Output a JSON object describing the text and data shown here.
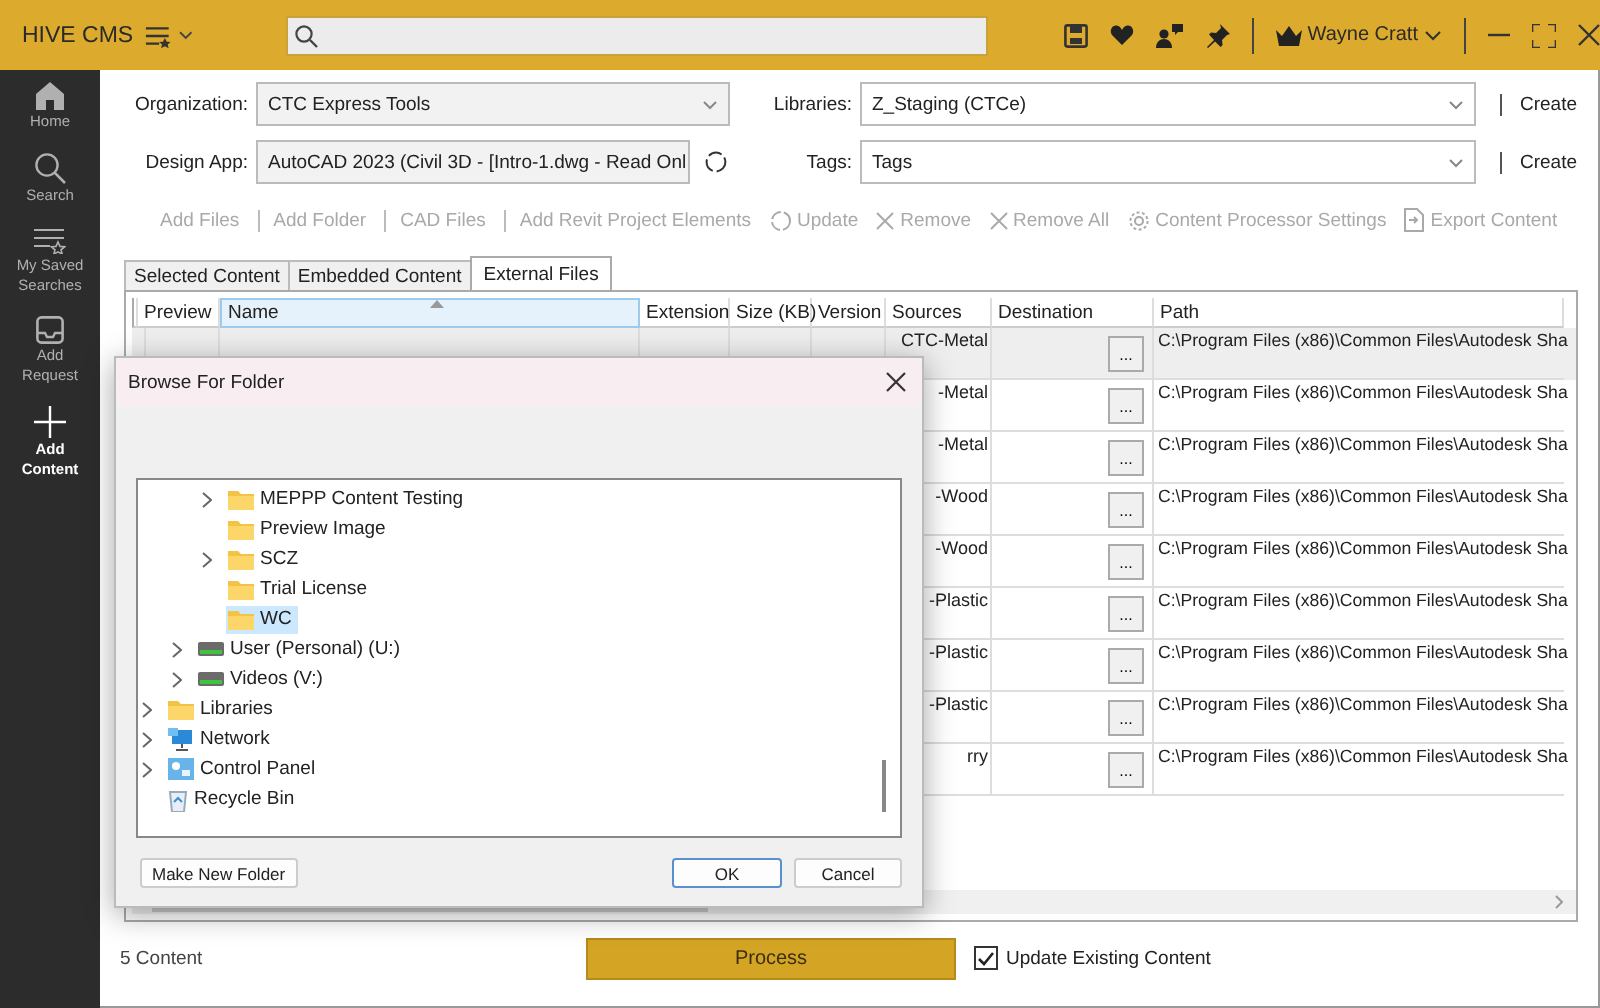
{
  "title_bar": {
    "app_name": "HIVE CMS",
    "user": "Wayne Cratt"
  },
  "sidebar": {
    "items": [
      {
        "label": "Home",
        "selected": false
      },
      {
        "label": "Search",
        "selected": false
      },
      {
        "label": "My Saved Searches",
        "selected": false
      },
      {
        "label": "Add Request",
        "selected": false
      },
      {
        "label": "Add Content",
        "selected": true
      }
    ]
  },
  "form": {
    "left": [
      {
        "label": "Organization:",
        "value": "CTC Express Tools",
        "refresh": false
      },
      {
        "label": "Design App:",
        "value": "AutoCAD 2023 (Civil 3D  - [Intro-1.dwg - Read Onl",
        "refresh": true
      }
    ],
    "right": [
      {
        "label": "Libraries:",
        "value": "Z_Staging (CTCe)",
        "action": "Create"
      },
      {
        "label": "Tags:",
        "value": "Tags",
        "action": "Create"
      }
    ]
  },
  "toolbar": [
    {
      "label": "Add Files",
      "kind": "text",
      "disabled": true
    },
    {
      "label": "Add Folder",
      "kind": "text",
      "disabled": true
    },
    {
      "label": "CAD Files",
      "kind": "text",
      "disabled": true
    },
    {
      "label": "Add Revit Project Elements",
      "kind": "text",
      "disabled": true
    },
    {
      "label": "Update",
      "kind": "update",
      "disabled": true
    },
    {
      "label": "Remove",
      "kind": "remove",
      "disabled": true
    },
    {
      "label": "Remove All",
      "kind": "remove",
      "disabled": true
    },
    {
      "label": "Content Processor Settings",
      "kind": "settings",
      "disabled": true
    },
    {
      "label": "Export Content",
      "kind": "export",
      "disabled": true
    }
  ],
  "tabs": [
    {
      "label": "Selected Content",
      "selected": false
    },
    {
      "label": "Embedded Content",
      "selected": false
    },
    {
      "label": "External Files",
      "selected": true
    }
  ],
  "table": {
    "columns": [
      {
        "label": "Preview",
        "sorted": false
      },
      {
        "label": "Name",
        "sorted": true
      },
      {
        "label": "Extension",
        "sorted": false
      },
      {
        "label": "Size (KB)",
        "sorted": false
      },
      {
        "label": "Version",
        "sorted": false
      },
      {
        "label": "Sources",
        "sorted": false
      },
      {
        "label": "Destination",
        "sorted": false
      },
      {
        "label": "Path",
        "sorted": false
      }
    ],
    "rows": [
      {
        "selected": true,
        "sources": "CTC-Metal",
        "destination_button": "...",
        "path": "C:\\Program Files (x86)\\Common Files\\Autodesk Sha"
      },
      {
        "selected": false,
        "sources": "-Metal",
        "destination_button": "...",
        "path": "C:\\Program Files (x86)\\Common Files\\Autodesk Sha"
      },
      {
        "selected": false,
        "sources": "-Metal",
        "destination_button": "...",
        "path": "C:\\Program Files (x86)\\Common Files\\Autodesk Sha"
      },
      {
        "selected": false,
        "sources": "-Wood",
        "destination_button": "...",
        "path": "C:\\Program Files (x86)\\Common Files\\Autodesk Sha"
      },
      {
        "selected": false,
        "sources": "-Wood",
        "destination_button": "...",
        "path": "C:\\Program Files (x86)\\Common Files\\Autodesk Sha"
      },
      {
        "selected": false,
        "sources": "-Plastic",
        "destination_button": "...",
        "path": "C:\\Program Files (x86)\\Common Files\\Autodesk Sha"
      },
      {
        "selected": false,
        "sources": "-Plastic",
        "destination_button": "...",
        "path": "C:\\Program Files (x86)\\Common Files\\Autodesk Sha"
      },
      {
        "selected": false,
        "sources": "-Plastic",
        "destination_button": "...",
        "path": "C:\\Program Files (x86)\\Common Files\\Autodesk Sha"
      },
      {
        "selected": false,
        "sources": "rry",
        "destination_button": "...",
        "path": "C:\\Program Files (x86)\\Common Files\\Autodesk Sha"
      }
    ]
  },
  "footer": {
    "count": "5 Content",
    "process_button": "Process",
    "option": {
      "label": "Update Existing Content",
      "checked": true
    }
  },
  "dialog": {
    "title": "Browse For Folder",
    "tree": [
      {
        "children": [
          {
            "children": [
              {
                "label": "MEPPP Content Testing",
                "kind": "folder",
                "has_children": true,
                "selected": false
              },
              {
                "label": "Preview Image",
                "kind": "folder",
                "has_children": false,
                "selected": false
              },
              {
                "label": "SCZ",
                "kind": "folder",
                "has_children": true,
                "selected": false
              },
              {
                "label": "Trial License",
                "kind": "folder",
                "has_children": false,
                "selected": false
              },
              {
                "label": "WC",
                "kind": "folder",
                "has_children": false,
                "selected": true
              }
            ]
          },
          {
            "label": "User (Personal) (U:)",
            "kind": "drive",
            "has_children": true,
            "selected": false
          },
          {
            "label": "Videos (V:)",
            "kind": "drive",
            "has_children": true,
            "selected": false
          }
        ]
      },
      {
        "label": "Libraries",
        "kind": "folder",
        "has_children": true,
        "selected": false
      },
      {
        "label": "Network",
        "kind": "network",
        "has_children": true,
        "selected": false
      },
      {
        "label": "Control Panel",
        "kind": "control-panel",
        "has_children": true,
        "selected": false
      },
      {
        "label": "Recycle Bin",
        "kind": "recycle-bin",
        "has_children": false,
        "selected": false
      }
    ],
    "buttons": [
      {
        "label": "Make New Folder",
        "kind": "secondary"
      },
      {
        "label": "OK",
        "kind": "default"
      },
      {
        "label": "Cancel",
        "kind": "secondary"
      }
    ]
  }
}
